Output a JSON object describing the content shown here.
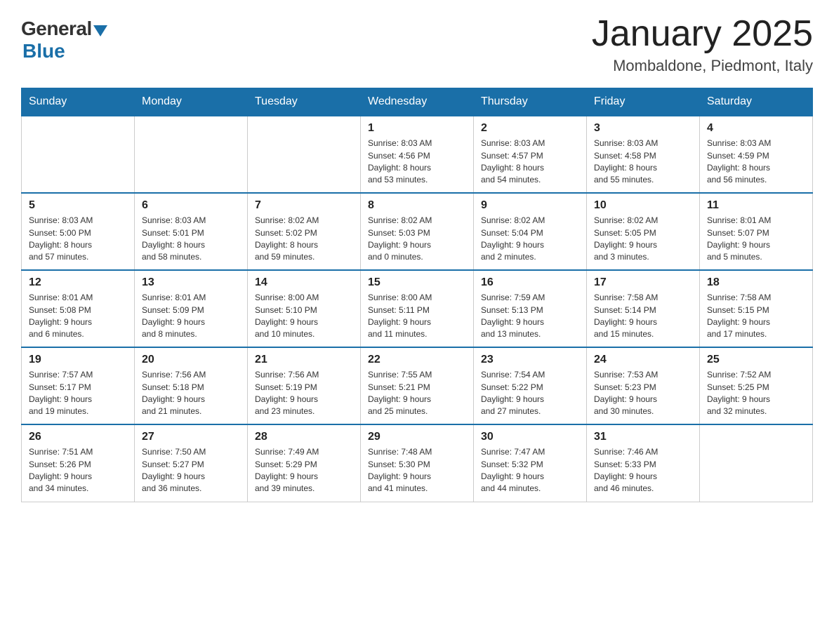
{
  "header": {
    "logo": {
      "general": "General",
      "blue": "Blue"
    },
    "title": "January 2025",
    "location": "Mombaldone, Piedmont, Italy"
  },
  "days_of_week": [
    "Sunday",
    "Monday",
    "Tuesday",
    "Wednesday",
    "Thursday",
    "Friday",
    "Saturday"
  ],
  "weeks": [
    [
      {
        "day": "",
        "info": ""
      },
      {
        "day": "",
        "info": ""
      },
      {
        "day": "",
        "info": ""
      },
      {
        "day": "1",
        "info": "Sunrise: 8:03 AM\nSunset: 4:56 PM\nDaylight: 8 hours\nand 53 minutes."
      },
      {
        "day": "2",
        "info": "Sunrise: 8:03 AM\nSunset: 4:57 PM\nDaylight: 8 hours\nand 54 minutes."
      },
      {
        "day": "3",
        "info": "Sunrise: 8:03 AM\nSunset: 4:58 PM\nDaylight: 8 hours\nand 55 minutes."
      },
      {
        "day": "4",
        "info": "Sunrise: 8:03 AM\nSunset: 4:59 PM\nDaylight: 8 hours\nand 56 minutes."
      }
    ],
    [
      {
        "day": "5",
        "info": "Sunrise: 8:03 AM\nSunset: 5:00 PM\nDaylight: 8 hours\nand 57 minutes."
      },
      {
        "day": "6",
        "info": "Sunrise: 8:03 AM\nSunset: 5:01 PM\nDaylight: 8 hours\nand 58 minutes."
      },
      {
        "day": "7",
        "info": "Sunrise: 8:02 AM\nSunset: 5:02 PM\nDaylight: 8 hours\nand 59 minutes."
      },
      {
        "day": "8",
        "info": "Sunrise: 8:02 AM\nSunset: 5:03 PM\nDaylight: 9 hours\nand 0 minutes."
      },
      {
        "day": "9",
        "info": "Sunrise: 8:02 AM\nSunset: 5:04 PM\nDaylight: 9 hours\nand 2 minutes."
      },
      {
        "day": "10",
        "info": "Sunrise: 8:02 AM\nSunset: 5:05 PM\nDaylight: 9 hours\nand 3 minutes."
      },
      {
        "day": "11",
        "info": "Sunrise: 8:01 AM\nSunset: 5:07 PM\nDaylight: 9 hours\nand 5 minutes."
      }
    ],
    [
      {
        "day": "12",
        "info": "Sunrise: 8:01 AM\nSunset: 5:08 PM\nDaylight: 9 hours\nand 6 minutes."
      },
      {
        "day": "13",
        "info": "Sunrise: 8:01 AM\nSunset: 5:09 PM\nDaylight: 9 hours\nand 8 minutes."
      },
      {
        "day": "14",
        "info": "Sunrise: 8:00 AM\nSunset: 5:10 PM\nDaylight: 9 hours\nand 10 minutes."
      },
      {
        "day": "15",
        "info": "Sunrise: 8:00 AM\nSunset: 5:11 PM\nDaylight: 9 hours\nand 11 minutes."
      },
      {
        "day": "16",
        "info": "Sunrise: 7:59 AM\nSunset: 5:13 PM\nDaylight: 9 hours\nand 13 minutes."
      },
      {
        "day": "17",
        "info": "Sunrise: 7:58 AM\nSunset: 5:14 PM\nDaylight: 9 hours\nand 15 minutes."
      },
      {
        "day": "18",
        "info": "Sunrise: 7:58 AM\nSunset: 5:15 PM\nDaylight: 9 hours\nand 17 minutes."
      }
    ],
    [
      {
        "day": "19",
        "info": "Sunrise: 7:57 AM\nSunset: 5:17 PM\nDaylight: 9 hours\nand 19 minutes."
      },
      {
        "day": "20",
        "info": "Sunrise: 7:56 AM\nSunset: 5:18 PM\nDaylight: 9 hours\nand 21 minutes."
      },
      {
        "day": "21",
        "info": "Sunrise: 7:56 AM\nSunset: 5:19 PM\nDaylight: 9 hours\nand 23 minutes."
      },
      {
        "day": "22",
        "info": "Sunrise: 7:55 AM\nSunset: 5:21 PM\nDaylight: 9 hours\nand 25 minutes."
      },
      {
        "day": "23",
        "info": "Sunrise: 7:54 AM\nSunset: 5:22 PM\nDaylight: 9 hours\nand 27 minutes."
      },
      {
        "day": "24",
        "info": "Sunrise: 7:53 AM\nSunset: 5:23 PM\nDaylight: 9 hours\nand 30 minutes."
      },
      {
        "day": "25",
        "info": "Sunrise: 7:52 AM\nSunset: 5:25 PM\nDaylight: 9 hours\nand 32 minutes."
      }
    ],
    [
      {
        "day": "26",
        "info": "Sunrise: 7:51 AM\nSunset: 5:26 PM\nDaylight: 9 hours\nand 34 minutes."
      },
      {
        "day": "27",
        "info": "Sunrise: 7:50 AM\nSunset: 5:27 PM\nDaylight: 9 hours\nand 36 minutes."
      },
      {
        "day": "28",
        "info": "Sunrise: 7:49 AM\nSunset: 5:29 PM\nDaylight: 9 hours\nand 39 minutes."
      },
      {
        "day": "29",
        "info": "Sunrise: 7:48 AM\nSunset: 5:30 PM\nDaylight: 9 hours\nand 41 minutes."
      },
      {
        "day": "30",
        "info": "Sunrise: 7:47 AM\nSunset: 5:32 PM\nDaylight: 9 hours\nand 44 minutes."
      },
      {
        "day": "31",
        "info": "Sunrise: 7:46 AM\nSunset: 5:33 PM\nDaylight: 9 hours\nand 46 minutes."
      },
      {
        "day": "",
        "info": ""
      }
    ]
  ]
}
